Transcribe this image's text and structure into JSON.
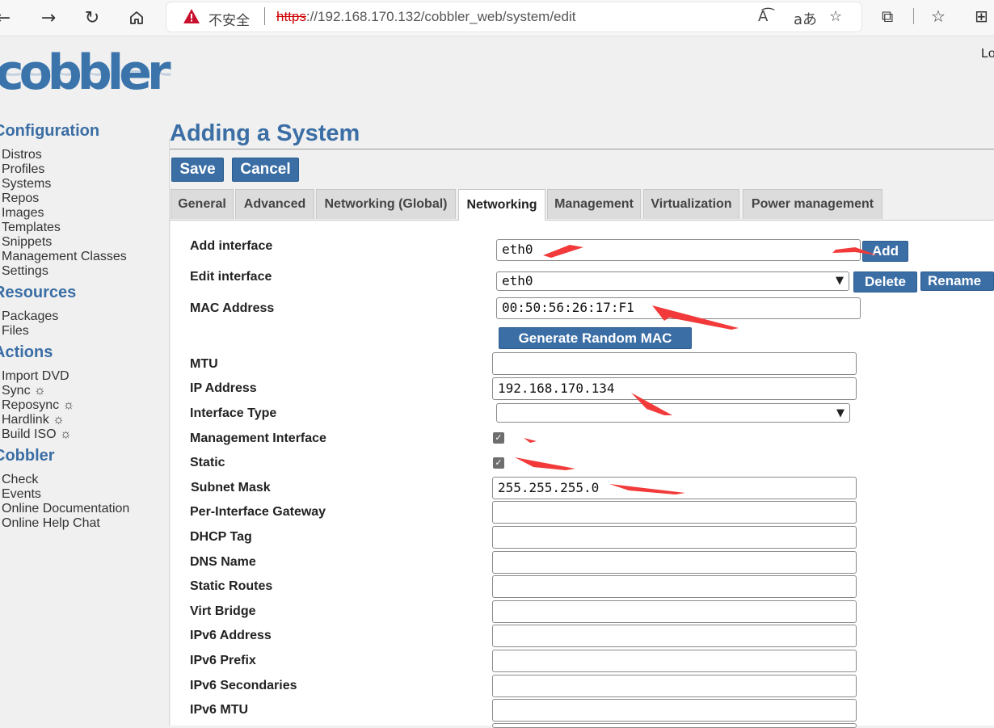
{
  "browser": {
    "insecure_label": "不安全",
    "url_scheme": "https",
    "url_rest": "://192.168.170.132/cobbler_web/system/edit"
  },
  "header": {
    "logo_text": "cobbler",
    "login_text": "Lo"
  },
  "sidebar": {
    "sections": [
      {
        "title": "Configuration",
        "links": [
          "Distros",
          "Profiles",
          "Systems",
          "Repos",
          "Images",
          "Templates",
          "Snippets",
          "Management Classes",
          "Settings"
        ]
      },
      {
        "title": "Resources",
        "links": [
          "Packages",
          "Files"
        ]
      },
      {
        "title": "Actions",
        "links": [
          "Import DVD",
          "Sync ☼",
          "Reposync ☼",
          "Hardlink ☼",
          "Build ISO ☼"
        ]
      },
      {
        "title": "Cobbler",
        "links": [
          "Check",
          "Events",
          "Online Documentation",
          "Online Help Chat"
        ]
      }
    ]
  },
  "main": {
    "title": "Adding a System",
    "save_label": "Save",
    "cancel_label": "Cancel",
    "tabs": [
      "General",
      "Advanced",
      "Networking (Global)",
      "Networking",
      "Management",
      "Virtualization",
      "Power management"
    ],
    "active_tab": "Networking"
  },
  "form": {
    "add_interface": {
      "label": "Add interface",
      "value": "eth0",
      "button": "Add"
    },
    "edit_interface": {
      "label": "Edit interface",
      "value": "eth0",
      "delete": "Delete",
      "rename": "Rename"
    },
    "mac_address": {
      "label": "MAC Address",
      "value": "00:50:56:26:17:F1",
      "button": "Generate Random MAC"
    },
    "mtu": {
      "label": "MTU",
      "value": ""
    },
    "ip_address": {
      "label": "IP Address",
      "value": "192.168.170.134"
    },
    "interface_type": {
      "label": "Interface Type",
      "value": ""
    },
    "management_interface": {
      "label": "Management Interface",
      "checked": true
    },
    "static": {
      "label": "Static",
      "checked": true
    },
    "subnet_mask": {
      "label": "Subnet Mask",
      "value": "255.255.255.0"
    },
    "gateway": {
      "label": "Per-Interface Gateway",
      "value": ""
    },
    "dhcp_tag": {
      "label": "DHCP Tag",
      "value": ""
    },
    "dns_name": {
      "label": "DNS Name",
      "value": ""
    },
    "static_routes": {
      "label": "Static Routes",
      "value": ""
    },
    "virt_bridge": {
      "label": "Virt Bridge",
      "value": ""
    },
    "ipv6_address": {
      "label": "IPv6 Address",
      "value": ""
    },
    "ipv6_prefix": {
      "label": "IPv6 Prefix",
      "value": ""
    },
    "ipv6_secondaries": {
      "label": "IPv6 Secondaries",
      "value": ""
    },
    "ipv6_mtu": {
      "label": "IPv6 MTU",
      "value": ""
    }
  },
  "colors": {
    "accent": "#3a6ea5",
    "annotation_arrow": "#f23a3a"
  }
}
